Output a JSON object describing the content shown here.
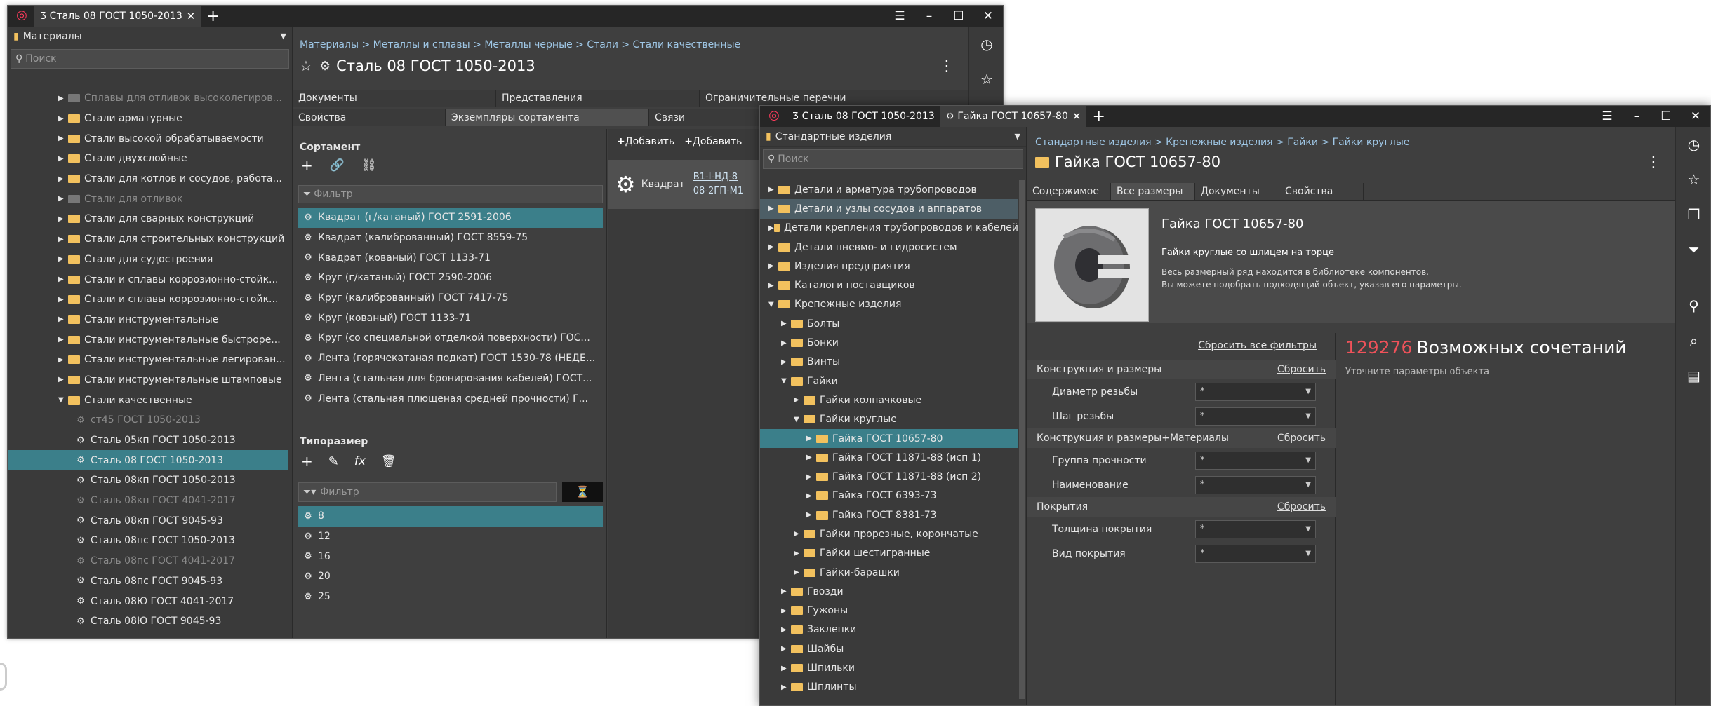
{
  "w1": {
    "tab_label": "Сталь 08 ГОСТ 1050-2013",
    "left": {
      "dropdown": "Материалы",
      "search_placeholder": "Поиск",
      "rows": [
        {
          "label": "Сплавы для отливок высоколегиров...",
          "dim": true,
          "level": 1,
          "tri": "▶",
          "folder": "grey"
        },
        {
          "label": "Стали арматурные",
          "level": 1,
          "tri": "▶",
          "folder": "y"
        },
        {
          "label": "Стали высокой обрабатываемости",
          "level": 1,
          "tri": "▶",
          "folder": "y"
        },
        {
          "label": "Стали двухслойные",
          "level": 1,
          "tri": "▶",
          "folder": "y"
        },
        {
          "label": "Стали для котлов и сосудов, работа...",
          "level": 1,
          "tri": "▶",
          "folder": "y"
        },
        {
          "label": "Стали для отливок",
          "dim": true,
          "level": 1,
          "tri": "▶",
          "folder": "grey"
        },
        {
          "label": "Стали для сварных конструкций",
          "level": 1,
          "tri": "▶",
          "folder": "y"
        },
        {
          "label": "Стали для строительных конструкций",
          "level": 1,
          "tri": "▶",
          "folder": "y"
        },
        {
          "label": "Стали для судостроения",
          "level": 1,
          "tri": "▶",
          "folder": "y"
        },
        {
          "label": "Стали и сплавы коррозионно-стойк...",
          "level": 1,
          "tri": "▶",
          "folder": "y"
        },
        {
          "label": "Стали и сплавы коррозионно-стойк...",
          "level": 1,
          "tri": "▶",
          "folder": "y"
        },
        {
          "label": "Стали инструментальные",
          "level": 1,
          "tri": "▶",
          "folder": "y"
        },
        {
          "label": "Стали инструментальные быстроре...",
          "level": 1,
          "tri": "▶",
          "folder": "y"
        },
        {
          "label": "Стали инструментальные легирован...",
          "level": 1,
          "tri": "▶",
          "folder": "y"
        },
        {
          "label": "Стали инструментальные штамповые",
          "level": 1,
          "tri": "▶",
          "folder": "y"
        },
        {
          "label": "Стали качественные",
          "level": 1,
          "tri": "▼",
          "folder": "y"
        },
        {
          "label": "ст45 ГОСТ 1050-2013",
          "dim": true,
          "level": 2,
          "gear": true
        },
        {
          "label": "Сталь 05кп ГОСТ 1050-2013",
          "level": 2,
          "gear": true
        },
        {
          "label": "Сталь 08 ГОСТ 1050-2013",
          "level": 2,
          "gear": true,
          "sel": true
        },
        {
          "label": "Сталь 08кп ГОСТ 1050-2013",
          "level": 2,
          "gear": true
        },
        {
          "label": "Сталь 08кп ГОСТ 4041-2017",
          "dim": true,
          "level": 2,
          "gear": true
        },
        {
          "label": "Сталь 08кп ГОСТ 9045-93",
          "level": 2,
          "gear": true
        },
        {
          "label": "Сталь 08пс ГОСТ 1050-2013",
          "level": 2,
          "gear": true
        },
        {
          "label": "Сталь 08пс ГОСТ 4041-2017",
          "dim": true,
          "level": 2,
          "gear": true
        },
        {
          "label": "Сталь 08пс ГОСТ 9045-93",
          "level": 2,
          "gear": true
        },
        {
          "label": "Сталь 08Ю ГОСТ 4041-2017",
          "level": 2,
          "gear": true
        },
        {
          "label": "Сталь 08Ю ГОСТ 9045-93",
          "level": 2,
          "gear": true
        }
      ]
    },
    "breadcrumb": "Материалы > Металлы и сплавы > Металлы черные > Стали > Стали качественные",
    "title": "Сталь 08 ГОСТ 1050-2013",
    "tabs_row1": [
      "Документы",
      "Представления",
      "Ограничительные перечни"
    ],
    "tabs_row2": [
      "Свойства",
      "Экземпляры сортамента",
      "Связи"
    ],
    "sortament_label": "Сортамент",
    "filter_placeholder": "Фильтр",
    "sortament": [
      "Квадрат (г/катаный) ГОСТ 2591-2006",
      "Квадрат (калиброванный) ГОСТ 8559-75",
      "Квадрат (кованый) ГОСТ 1133-71",
      "Круг (г/катаный) ГОСТ 2590-2006",
      "Круг (калиброванный) ГОСТ 7417-75",
      "Круг (кованый) ГОСТ 1133-71",
      "Круг (со специальной отделкой поверхности) ГОС...",
      "Лента (горячекатаная подкат) ГОСТ 1530-78 (НЕДЕ...",
      "Лента (стальная для бронирования кабелей) ГОСТ...",
      "Лента (стальная плющеная средней прочности) Г..."
    ],
    "tiporazmer_label": "Типоразмер",
    "sizes": [
      "8",
      "12",
      "16",
      "20",
      "25"
    ],
    "add_label": "Добавить",
    "card_label": "Квадрат",
    "card_code1": "В1-I-НД-8",
    "card_code2": "08-2ГП-М1"
  },
  "w2": {
    "tab1": "Сталь 08 ГОСТ 1050-2013",
    "tab2": "Гайка ГОСТ 10657-80",
    "dropdown": "Стандартные изделия",
    "search_placeholder": "Поиск",
    "rows": [
      {
        "label": "Детали и арматура трубопроводов",
        "level": 0,
        "tri": "▶"
      },
      {
        "label": "Детали и узлы сосудов и аппаратов",
        "level": 0,
        "tri": "▶",
        "hl": true
      },
      {
        "label": "Детали крепления трубопроводов и кабелей",
        "level": 0,
        "tri": "▶"
      },
      {
        "label": "Детали пневмо- и гидросистем",
        "level": 0,
        "tri": "▶"
      },
      {
        "label": "Изделия предприятия",
        "level": 0,
        "tri": "▶"
      },
      {
        "label": "Каталоги поставщиков",
        "level": 0,
        "tri": "▶"
      },
      {
        "label": "Крепежные изделия",
        "level": 0,
        "tri": "▼"
      },
      {
        "label": "Болты",
        "level": 1,
        "tri": "▶"
      },
      {
        "label": "Бонки",
        "level": 1,
        "tri": "▶"
      },
      {
        "label": "Винты",
        "level": 1,
        "tri": "▶"
      },
      {
        "label": "Гайки",
        "level": 1,
        "tri": "▼"
      },
      {
        "label": "Гайки колпачковые",
        "level": 2,
        "tri": "▶"
      },
      {
        "label": "Гайки круглые",
        "level": 2,
        "tri": "▼"
      },
      {
        "label": "Гайка ГОСТ 10657-80",
        "level": 3,
        "tri": "▶",
        "sel": true
      },
      {
        "label": "Гайка ГОСТ 11871-88 (исп 1)",
        "level": 3,
        "tri": "▶"
      },
      {
        "label": "Гайка ГОСТ 11871-88 (исп 2)",
        "level": 3,
        "tri": "▶"
      },
      {
        "label": "Гайка ГОСТ 6393-73",
        "level": 3,
        "tri": "▶"
      },
      {
        "label": "Гайка ГОСТ 8381-73",
        "level": 3,
        "tri": "▶"
      },
      {
        "label": "Гайки прорезные, корончатые",
        "level": 2,
        "tri": "▶"
      },
      {
        "label": "Гайки шестигранные",
        "level": 2,
        "tri": "▶"
      },
      {
        "label": "Гайки-барашки",
        "level": 2,
        "tri": "▶"
      },
      {
        "label": "Гвозди",
        "level": 1,
        "tri": "▶"
      },
      {
        "label": "Гужоны",
        "level": 1,
        "tri": "▶"
      },
      {
        "label": "Заклепки",
        "level": 1,
        "tri": "▶"
      },
      {
        "label": "Шайбы",
        "level": 1,
        "tri": "▶"
      },
      {
        "label": "Шпильки",
        "level": 1,
        "tri": "▶"
      },
      {
        "label": "Шплинты",
        "level": 1,
        "tri": "▶"
      }
    ],
    "breadcrumb": "Стандартные изделия > Крепежные изделия > Гайки > Гайки круглые",
    "title": "Гайка ГОСТ 10657-80",
    "tabs": [
      "Содержимое",
      "Все размеры",
      "Документы",
      "Свойства"
    ],
    "info_title": "Гайка ГОСТ 10657-80",
    "info_sub": "Гайки круглые со шлицем на торце",
    "info_line1": "Весь размерный ряд находится в библиотеке компонентов.",
    "info_line2": "Вы можете подобрать подходящий объект, указав его параметры.",
    "reset_all": "Сбросить все фильтры",
    "count": "129276",
    "count_label": "Возможных сочетаний",
    "hint": "Уточните параметры объекта",
    "reset": "Сбросить",
    "groups": [
      {
        "name": "Конструкция и размеры",
        "fields": [
          "Диаметр резьбы",
          "Шаг резьбы"
        ]
      },
      {
        "name": "Конструкция и размеры+Материалы",
        "fields": [
          "Группа прочности",
          "Наименование"
        ]
      },
      {
        "name": "Покрытия",
        "fields": [
          "Толщина покрытия",
          "Вид покрытия"
        ]
      }
    ],
    "select_value": "*"
  }
}
